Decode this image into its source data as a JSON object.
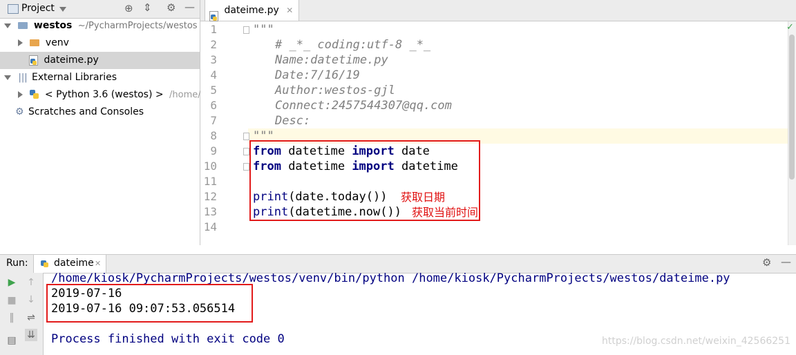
{
  "project_panel": {
    "title": "Project",
    "tree": {
      "root_name": "westos",
      "root_path": "~/PycharmProjects/westos",
      "venv": "venv",
      "file": "dateime.py",
      "external_libraries": "External Libraries",
      "python_sdk": "< Python 3.6 (westos) >",
      "python_sdk_path": "/home/kio",
      "scratches": "Scratches and Consoles"
    }
  },
  "editor": {
    "tab_label": "dateime.py",
    "line_numbers": [
      "1",
      "2",
      "3",
      "4",
      "5",
      "6",
      "7",
      "8",
      "9",
      "10",
      "11",
      "12",
      "13",
      "14"
    ],
    "docstring": {
      "open": "\"\"\"",
      "l2": "# _*_ coding:utf-8 _*_",
      "l3": "Name:datetime.py",
      "l4": "Date:7/16/19",
      "l5": "Author:westos-gjl",
      "l6": "Connect:2457544307@qq.com",
      "l7": "Desc:",
      "close": "\"\"\""
    },
    "code": {
      "from": "from",
      "import": "import",
      "mod1": " datetime ",
      "name1": " date",
      "name2": " datetime",
      "print": "print",
      "arg12": "(date.today())",
      "arg13": "(datetime.now())"
    },
    "annotations": {
      "note12": "获取日期",
      "note13": "获取当前时间"
    }
  },
  "run_panel": {
    "label": "Run:",
    "tab_label": "dateime",
    "output": {
      "command": "/home/kiosk/PycharmProjects/westos/venv/bin/python /home/kiosk/PycharmProjects/westos/dateime.py",
      "line1": "2019-07-16",
      "line2": "2019-07-16 09:07:53.056514",
      "finished": "Process finished with exit code 0"
    }
  },
  "watermark": "https://blog.csdn.net/weixin_42566251",
  "colors": {
    "keyword": "#000080",
    "comment": "#808080",
    "annotation_red": "#e01010",
    "box_red": "#e21b1b"
  }
}
